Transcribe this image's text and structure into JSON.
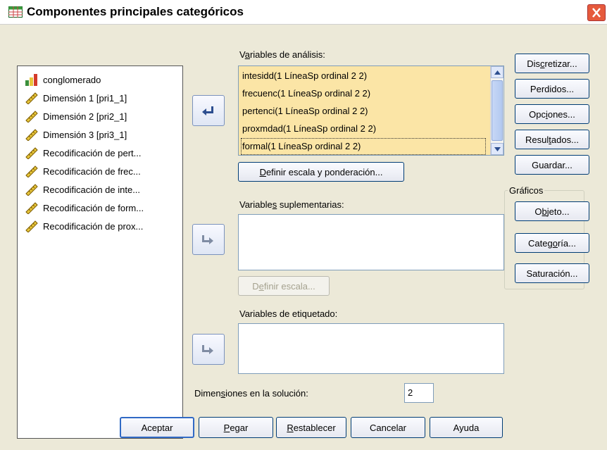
{
  "window": {
    "title": "Componentes principales categóricos"
  },
  "source_list": {
    "items": [
      {
        "label": "conglomerado",
        "icon": "nominal-bar-icon"
      },
      {
        "label": "Dimensión 1 [pri1_1]",
        "icon": "ruler-scale-icon"
      },
      {
        "label": "Dimensión 2 [pri2_1]",
        "icon": "ruler-scale-icon"
      },
      {
        "label": "Dimensión 3 [pri3_1]",
        "icon": "ruler-scale-icon"
      },
      {
        "label": "Recodificación de pert...",
        "icon": "ruler-scale-icon"
      },
      {
        "label": "Recodificación de frec...",
        "icon": "ruler-scale-icon"
      },
      {
        "label": "Recodificación de inte...",
        "icon": "ruler-scale-icon"
      },
      {
        "label": "Recodificación de form...",
        "icon": "ruler-scale-icon"
      },
      {
        "label": "Recodificación de prox...",
        "icon": "ruler-scale-icon"
      }
    ]
  },
  "analysis": {
    "label_pre": "V",
    "label_u": "a",
    "label_post": "riables de análisis:",
    "items": [
      "intesidd(1 LíneaSp ordinal 2 2)",
      "frecuenc(1 LíneaSp ordinal 2 2)",
      "pertenci(1 LíneaSp ordinal 2 2)",
      "proxmdad(1 LíneaSp ordinal 2 2)",
      "formal(1 LíneaSp ordinal 2 2)"
    ],
    "define_btn": {
      "pre": "",
      "u": "D",
      "post": "efinir escala y ponderación..."
    }
  },
  "supplementary": {
    "label_pre": "Variable",
    "label_u": "s",
    "label_post": " suplementarias:",
    "define_btn": {
      "pre": "D",
      "u": "e",
      "post": "finir escala..."
    }
  },
  "labeling": {
    "label": "Variables de etiquetado:"
  },
  "dimensions": {
    "label_pre": "Dimen",
    "label_u": "s",
    "label_post": "iones en la solución:",
    "value": "2"
  },
  "right_buttons": {
    "discretize": {
      "pre": "Dis",
      "u": "c",
      "post": "retizar..."
    },
    "missing": {
      "pre": "Perdidos...",
      "u": "",
      "post": ""
    },
    "options": {
      "pre": "Opc",
      "u": "i",
      "post": "ones..."
    },
    "output": {
      "pre": "Resul",
      "u": "t",
      "post": "ados..."
    },
    "save": {
      "pre": "Guardar...",
      "u": "",
      "post": ""
    }
  },
  "plots": {
    "legend": "Gráficos",
    "object": {
      "pre": "O",
      "u": "b",
      "post": "jeto..."
    },
    "category": {
      "pre": "Categ",
      "u": "o",
      "post": "ría..."
    },
    "loading": {
      "pre": "Saturación...",
      "u": "",
      "post": ""
    }
  },
  "bottom_buttons": {
    "ok": "Aceptar",
    "paste": {
      "pre": "",
      "u": "P",
      "post": "egar"
    },
    "reset": {
      "pre": "",
      "u": "R",
      "post": "establecer"
    },
    "cancel": "Cancelar",
    "help": "Ayuda"
  },
  "colors": {
    "selected_bg": "#fbe5a6",
    "dialog_bg": "#ece9d8",
    "title_bg": "#ffffff",
    "close": "#e65a3c"
  }
}
